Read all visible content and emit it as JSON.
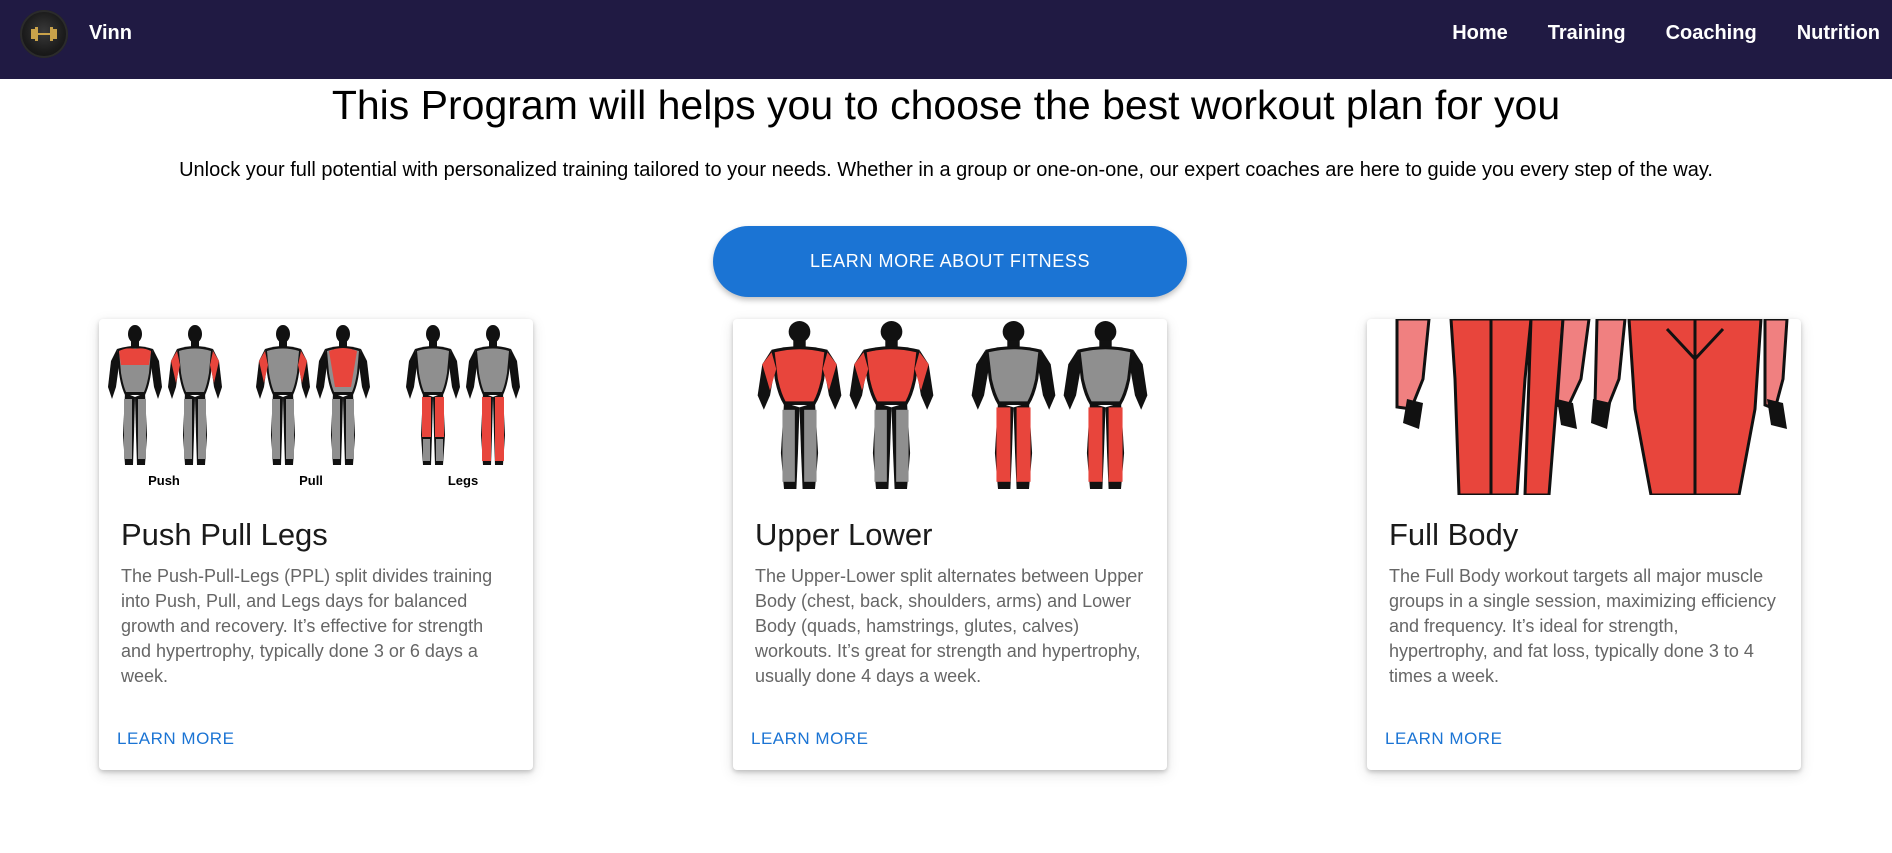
{
  "nav": {
    "brand": "Vinn",
    "links": [
      "Home",
      "Training",
      "Coaching",
      "Nutrition"
    ]
  },
  "hero": {
    "title": "This Program will helps you to choose the best workout plan for you",
    "subtitle": "Unlock your full potential with personalized training tailored to your needs. Whether in a group or one-on-one, our expert coaches are here to guide you every step of the way.",
    "cta_label": "LEARN MORE ABOUT FITNESS"
  },
  "cards": [
    {
      "title": "Push Pull Legs",
      "text": "The Push-Pull-Legs (PPL) split divides training into Push, Pull, and Legs days for balanced growth and recovery. It’s effective for strength and hypertrophy, typically done 3 or 6 days a week.",
      "link": "LEARN MORE",
      "figure_labels": [
        "Push",
        "Pull",
        "Legs"
      ]
    },
    {
      "title": "Upper Lower",
      "text": "The Upper-Lower split alternates between Upper Body (chest, back, shoulders, arms) and Lower Body (quads, hamstrings, glutes, calves) workouts. It’s great for strength and hypertrophy, usually done 4 days a week.",
      "link": "LEARN MORE"
    },
    {
      "title": "Full Body",
      "text": "The Full Body workout targets all major muscle groups in a single session, maximizing efficiency and frequency. It’s ideal for strength, hypertrophy, and fat loss, typically done 3 to 4 times a week.",
      "link": "LEARN MORE"
    }
  ],
  "colors": {
    "navbar": "#201a43",
    "accent": "#1b74d4",
    "muscle_highlight": "#e8453c",
    "muscle_base": "#8f8f8f",
    "outline": "#111111"
  }
}
